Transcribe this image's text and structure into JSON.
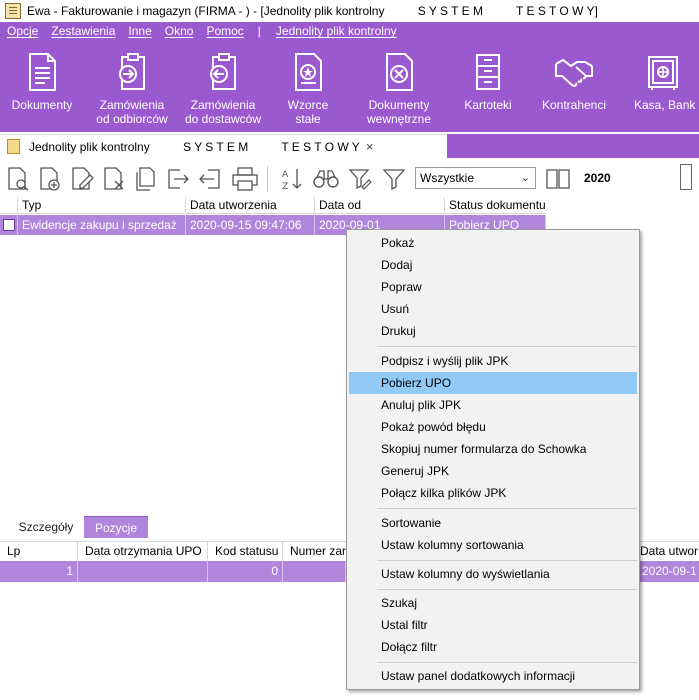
{
  "window": {
    "title": "Ewa - Fakturowanie i magazyn (FIRMA - ) - [Jednolity plik kontrolny          S Y S T E M          T E S T O W Y]"
  },
  "menubar": {
    "items": [
      "Opcje",
      "Zestawienia",
      "Inne",
      "Okno",
      "Pomoc"
    ],
    "separator": "|",
    "active_item": "Jednolity plik kontrolny"
  },
  "ribbon": {
    "buttons": [
      {
        "label": "Dokumenty",
        "icon": "document-icon"
      },
      {
        "label": "Zamówienia\nod odbiorców",
        "icon": "order-in-icon"
      },
      {
        "label": "Zamówienia\ndo dostawców",
        "icon": "order-out-icon"
      },
      {
        "label": "Wzorce\nstałe",
        "icon": "template-icon"
      },
      {
        "label": "Dokumenty\nwewnętrzne",
        "icon": "internal-document-icon"
      },
      {
        "label": "Kartoteki",
        "icon": "cabinet-icon"
      },
      {
        "label": "Kontrahenci",
        "icon": "handshake-icon"
      },
      {
        "label": "Kasa, Bank",
        "icon": "safe-icon"
      }
    ]
  },
  "doc_tab": {
    "title": "Jednolity plik kontrolny          S Y S T E M          T E S T O W Y",
    "close": "×"
  },
  "toolbar": {
    "filter_value": "Wszystkie",
    "year": "2020"
  },
  "grid": {
    "headers": [
      "Typ",
      "Data utworzenia",
      "Data od",
      "Status dokumentu"
    ],
    "rows": [
      {
        "typ": "Ewidencje zakupu i sprzedaż",
        "data_utworzenia": "2020-09-15 09:47:06",
        "data_od": "2020-09-01",
        "status": "Pobierz UPO"
      }
    ]
  },
  "bottom": {
    "tabs": [
      "Szczegóły",
      "Pozycje"
    ],
    "headers": [
      "Lp",
      "Data otrzymania UPO",
      "Kod statusu",
      "Numer zarej"
    ],
    "right_header": "Data utwor",
    "row": {
      "lp": "1",
      "data_upo": "",
      "kod": "0",
      "numer": "",
      "right": "2020-09-1"
    }
  },
  "context_menu": {
    "items": [
      "Pokaż",
      "Dodaj",
      "Popraw",
      "Usuń",
      "Drukuj",
      "Podpisz i wyślij plik JPK",
      "Pobierz UPO",
      "Anuluj plik JPK",
      "Pokaż powód błędu",
      "Skopiuj numer formularza do Schowka",
      "Generuj JPK",
      "Połącz kilka plików JPK",
      "Sortowanie",
      "Ustaw kolumny sortowania",
      "Ustaw kolumny do wyświetlania",
      "Szukaj",
      "Ustal filtr",
      "Dołącz filtr",
      "Ustaw panel dodatkowych informacji"
    ],
    "highlighted": "Pobierz UPO"
  },
  "colors": {
    "accent": "#9b59d0",
    "selection": "#b185dc",
    "menu_highlight": "#91c9f7"
  }
}
